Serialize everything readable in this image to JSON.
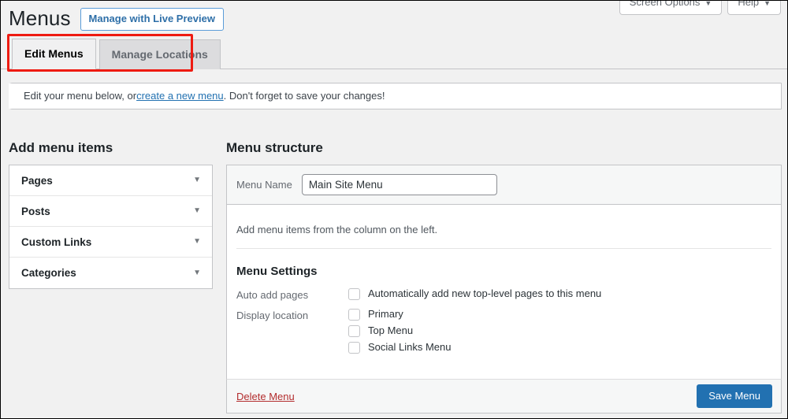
{
  "screen_meta": {
    "screen_options_label": "Screen Options",
    "help_label": "Help",
    "caret": "▼"
  },
  "header": {
    "page_title": "Menus",
    "live_preview_button": "Manage with Live Preview"
  },
  "tabs": [
    {
      "label": "Edit Menus",
      "active": true
    },
    {
      "label": "Manage Locations",
      "active": false
    }
  ],
  "notice": {
    "text_before": "Edit your menu below, or ",
    "link_text": "create a new menu",
    "text_after": ". Don't forget to save your changes!"
  },
  "add_menu_items": {
    "heading": "Add menu items",
    "panels": [
      {
        "label": "Pages",
        "caret": "▼"
      },
      {
        "label": "Posts",
        "caret": "▼"
      },
      {
        "label": "Custom Links",
        "caret": "▼"
      },
      {
        "label": "Categories",
        "caret": "▼"
      }
    ]
  },
  "menu_structure": {
    "heading": "Menu structure",
    "menu_name_label": "Menu Name",
    "menu_name_value": "Main Site Menu",
    "menu_name_placeholder": "Menu Name",
    "empty_message": "Add menu items from the column on the left."
  },
  "menu_settings": {
    "heading": "Menu Settings",
    "auto_add_label": "Auto add pages",
    "auto_add_option": "Automatically add new top-level pages to this menu",
    "auto_add_checked": false,
    "display_location_label": "Display location",
    "locations": [
      {
        "label": "Primary",
        "checked": false
      },
      {
        "label": "Top Menu",
        "checked": false
      },
      {
        "label": "Social Links Menu",
        "checked": false
      }
    ]
  },
  "footer": {
    "delete_label": "Delete Menu",
    "save_label": "Save Menu"
  },
  "colors": {
    "accent_blue": "#2271b1",
    "link_blue": "#2271b1",
    "delete_red": "#b32d2e",
    "highlight_red": "#ee1b11",
    "page_bg": "#f1f1f1",
    "border_gray": "#c3c4c7"
  }
}
